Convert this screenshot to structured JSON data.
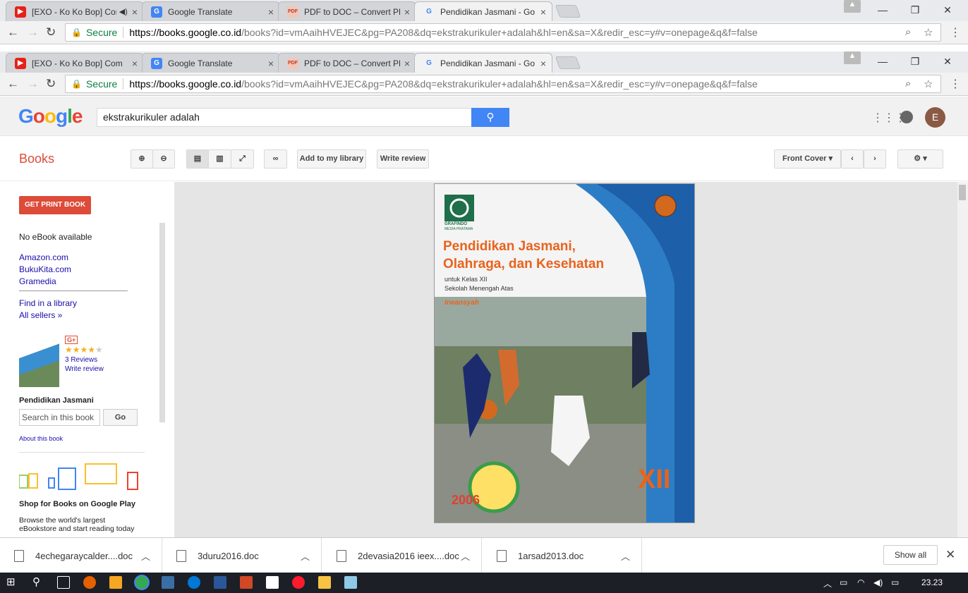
{
  "tabs": [
    {
      "title": "[EXO - Ko Ko Bop] Com",
      "favicon": "youtube-icon",
      "color": "#e62117"
    },
    {
      "title": "Google Translate",
      "favicon": "translate-icon",
      "color": "#4285f4"
    },
    {
      "title": "PDF to DOC – Convert PD",
      "favicon": "pdf-icon",
      "color": "#e07050"
    },
    {
      "title": "Pendidikan Jasmani - Go",
      "favicon": "google-icon",
      "color": "#4285f4"
    }
  ],
  "address": {
    "secure": "Secure",
    "host": "https://books.google.co.id",
    "path": "/books?id=vmAaihHVEJEC&pg=PA208&dq=ekstrakurikuler+adalah&hl=en&sa=X&redir_esc=y#v=onepage&q&f=false"
  },
  "google": {
    "logo": "Google",
    "search_value": "ekstrakurikuler adalah",
    "avatar_letter": "E"
  },
  "toolbar": {
    "books_title": "Books",
    "add_library": "Add to my library",
    "write_review": "Write review",
    "front_cover": "Front Cover"
  },
  "sidebar": {
    "get_print": "GET PRINT BOOK",
    "no_ebook": "No eBook available",
    "sellers": [
      "Amazon.com",
      "BukuKita.com",
      "Gramedia"
    ],
    "find_library": "Find in a library",
    "all_sellers": "All sellers »",
    "gplus": "G+",
    "rating": 4,
    "reviews": "3 Reviews",
    "write_review": "Write review",
    "book_title": "Pendidikan Jasmani",
    "search_placeholder": "Search in this book",
    "go": "Go",
    "about": "About this book",
    "shop_title": "Shop for Books on Google Play",
    "shop_text": "Browse the world's largest eBookstore and start reading today"
  },
  "cover": {
    "publisher": "GRAFINDO",
    "publisher_sub": "MEDIA PRATAMA",
    "title_line1": "Pendidikan Jasmani,",
    "title_line2": "Olahraga, dan Kesehatan",
    "subtitle1": "untuk Kelas XII",
    "subtitle2": "Sekolah Menengah Atas",
    "author": "Irwansyah",
    "grade": "XII",
    "year": "2006"
  },
  "downloads": [
    "4echegaraycalder....doc",
    "3duru2016.doc",
    "2devasia2016 ieex....doc",
    "1arsad2013.doc"
  ],
  "show_all": "Show all",
  "clock": "23.23"
}
